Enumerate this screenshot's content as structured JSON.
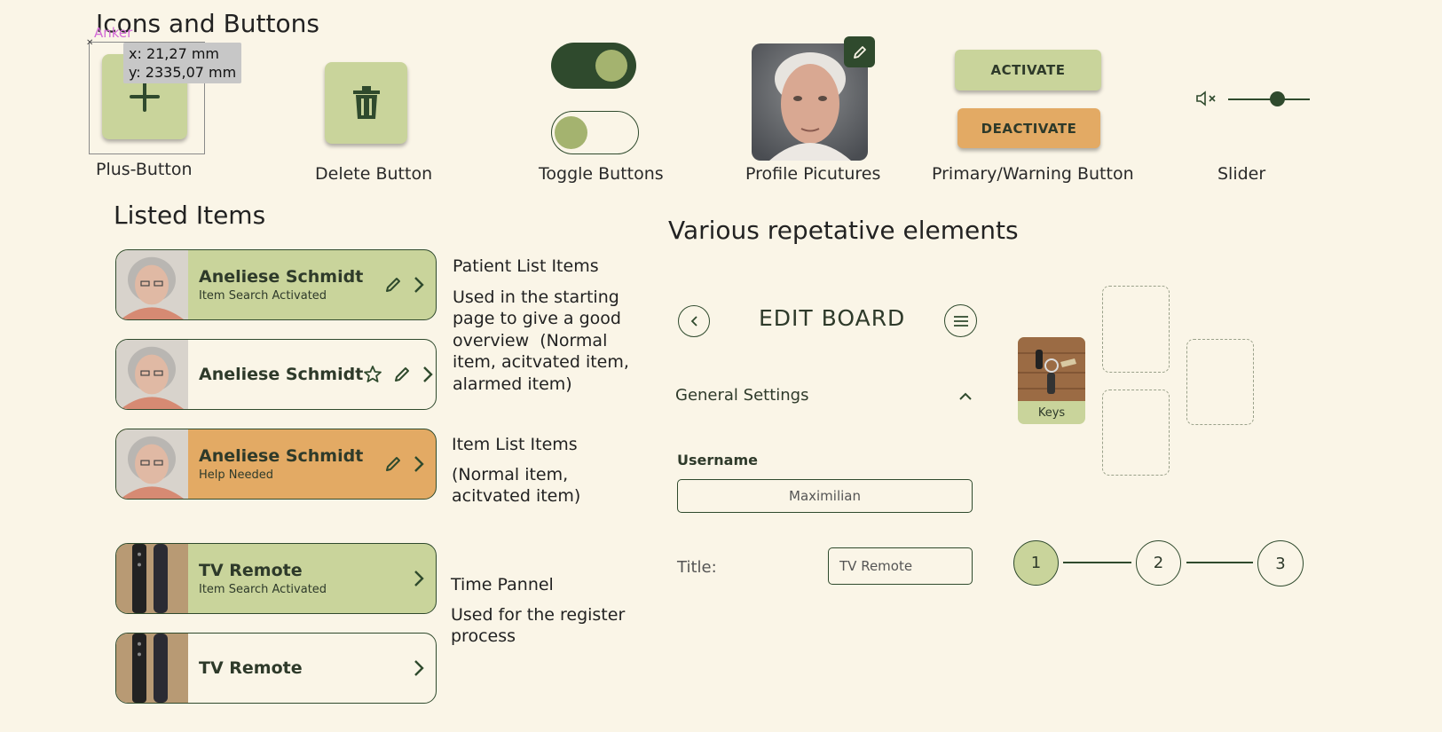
{
  "sections": {
    "icons_buttons_title": "Icons and Buttons",
    "listed_items_title": "Listed Items",
    "repetitive_title": "Various repetative elements"
  },
  "anchor": {
    "label": "Anker",
    "x": "x: 21,27 mm",
    "y": "y: 2335,07 mm"
  },
  "captions": {
    "plus": "Plus-Button",
    "delete": "Delete Button",
    "toggle": "Toggle Buttons",
    "profile": "Profile Picutures",
    "primary_warning": "Primary/Warning Button",
    "slider": "Slider"
  },
  "buttons": {
    "activate": "ACTIVATE",
    "deactivate": "DEACTIVATE"
  },
  "toggles": [
    {
      "state": "on"
    },
    {
      "state": "off"
    }
  ],
  "slider": {
    "value": 0.6
  },
  "list_items": [
    {
      "name": "Aneliese Schmidt",
      "sub": "Item Search Activated",
      "style": "green"
    },
    {
      "name": "Aneliese Schmidt",
      "sub": "",
      "style": "cream"
    },
    {
      "name": "Aneliese Schmidt",
      "sub": "Help Needed",
      "style": "orange"
    },
    {
      "name": "TV Remote",
      "sub": "Item Search Activated",
      "style": "green"
    },
    {
      "name": "TV Remote",
      "sub": "",
      "style": "cream"
    }
  ],
  "descriptions": {
    "patient_title": "Patient List Items",
    "patient_body": [
      "Used in the starting",
      "page to give a good",
      "overview  (Normal",
      "item, acitvated item,",
      "alarmed item)"
    ],
    "item_title": "Item List Items",
    "item_body": [
      "(Normal item,",
      "acitvated item)"
    ],
    "time_title": "Time Pannel",
    "time_body": [
      "Used for the register",
      "process"
    ]
  },
  "edit_board": {
    "title": "EDIT BOARD",
    "general_settings": "General Settings",
    "username_label": "Username",
    "username_value": "Maximilian",
    "title_label": "Title:",
    "title_value": "TV Remote"
  },
  "board_item": {
    "label": "Keys"
  },
  "stepper": [
    "1",
    "2",
    "3"
  ],
  "colors": {
    "background": "#faf5e7",
    "primary": "#c9d49b",
    "warning": "#e3aa64",
    "dark": "#2f4a2d"
  }
}
